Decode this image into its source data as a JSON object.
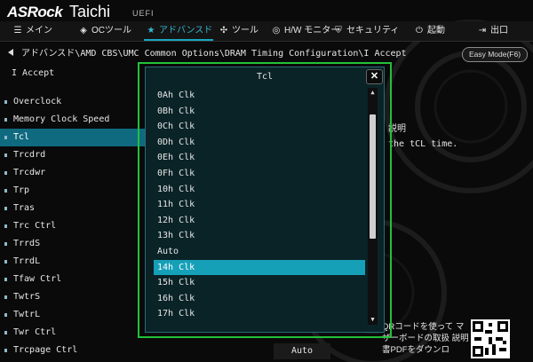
{
  "header": {
    "brand": "ASRock",
    "model": "Taichi",
    "firmware": "UEFI"
  },
  "nav": {
    "tabs": [
      {
        "label": "メイン",
        "icon": "menu-icon"
      },
      {
        "label": "OCツール",
        "icon": "rocket-icon"
      },
      {
        "label": "アドバンスド",
        "icon": "star-icon",
        "active": true
      },
      {
        "label": "ツール",
        "icon": "tools-icon"
      },
      {
        "label": "H/W モニター",
        "icon": "monitor-icon"
      },
      {
        "label": "セキュリティ",
        "icon": "shield-icon"
      },
      {
        "label": "起動",
        "icon": "power-icon"
      },
      {
        "label": "出口",
        "icon": "exit-icon"
      }
    ]
  },
  "breadcrumb": {
    "path": "アドバンスド\\AMD CBS\\UMC Common Options\\DRAM Timing Configuration\\I Accept"
  },
  "easy_mode": {
    "label": "Easy Mode(F6)"
  },
  "left": {
    "accept_label": "I Accept",
    "items": [
      "Overclock",
      "Memory Clock Speed",
      "Tcl",
      "Trcdrd",
      "Trcdwr",
      "Trp",
      "Tras",
      "Trc Ctrl",
      "TrrdS",
      "TrrdL",
      "Tfaw Ctrl",
      "TwtrS",
      "TwtrL",
      "Twr Ctrl",
      "Trcpage Ctrl"
    ],
    "selected_index": 2
  },
  "description": {
    "title": "説明",
    "text": "the tCL time."
  },
  "qr": {
    "text": "QRコードを使って マザーボードの取扱 説明書PDFをダウンロ"
  },
  "current_value": "Auto",
  "modal": {
    "title": "Tcl",
    "close_label": "✕",
    "options": [
      "0Ah Clk",
      "0Bh Clk",
      "0Ch Clk",
      "0Dh Clk",
      "0Eh Clk",
      "0Fh Clk",
      "10h Clk",
      "11h Clk",
      "12h Clk",
      "13h Clk",
      "Auto",
      "14h Clk",
      "15h Clk",
      "16h Clk",
      "17h Clk"
    ],
    "selected_index": 11,
    "scroll_up": "▲",
    "scroll_down": "▼"
  },
  "colors": {
    "accent": "#1aa6c0",
    "highlight_outline": "#23c13a",
    "modal_bg": "#0a2327"
  }
}
